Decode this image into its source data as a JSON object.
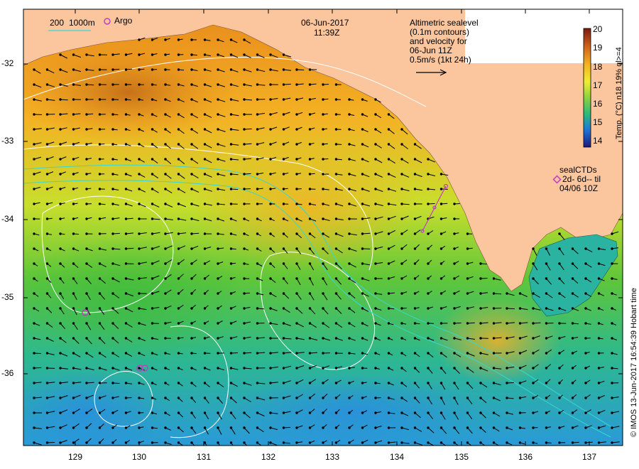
{
  "map": {
    "date": "06-Jun-2017",
    "time": "11:39Z",
    "description_lines": [
      "Altimetric sealevel",
      "(0.1m contours)",
      "and velocity for",
      "06-Jun 11Z",
      "0.5m/s (1kt 24h)"
    ],
    "legend_isobaths": [
      "200",
      "1000m"
    ],
    "legend_argo": "Argo",
    "sealctd_lines": [
      "sealCTDs",
      "2d- 6d-- til",
      "04/06 10Z"
    ],
    "credit": "© IMOS 13-Jun-2017 16:54:39 Hobart time",
    "x_ticks": [
      "129",
      "130",
      "131",
      "132",
      "133",
      "134",
      "135",
      "136",
      "137"
    ],
    "y_ticks": [
      "-32",
      "-33",
      "-34",
      "-35",
      "-36"
    ],
    "colorbar": {
      "label": "Temp. (°C) n18 19% ql>=4",
      "ticks": [
        "20",
        "19",
        "18",
        "17",
        "16",
        "15",
        "14"
      ],
      "range": [
        13.6,
        20
      ]
    },
    "colors": {
      "land": "#fbc69e",
      "warm": "#d07618",
      "cool": "#2a9ad8",
      "vector": "#000000",
      "contour": "#ffffff",
      "isobath": "#3ad6d0",
      "argo": "#c040c0"
    }
  }
}
